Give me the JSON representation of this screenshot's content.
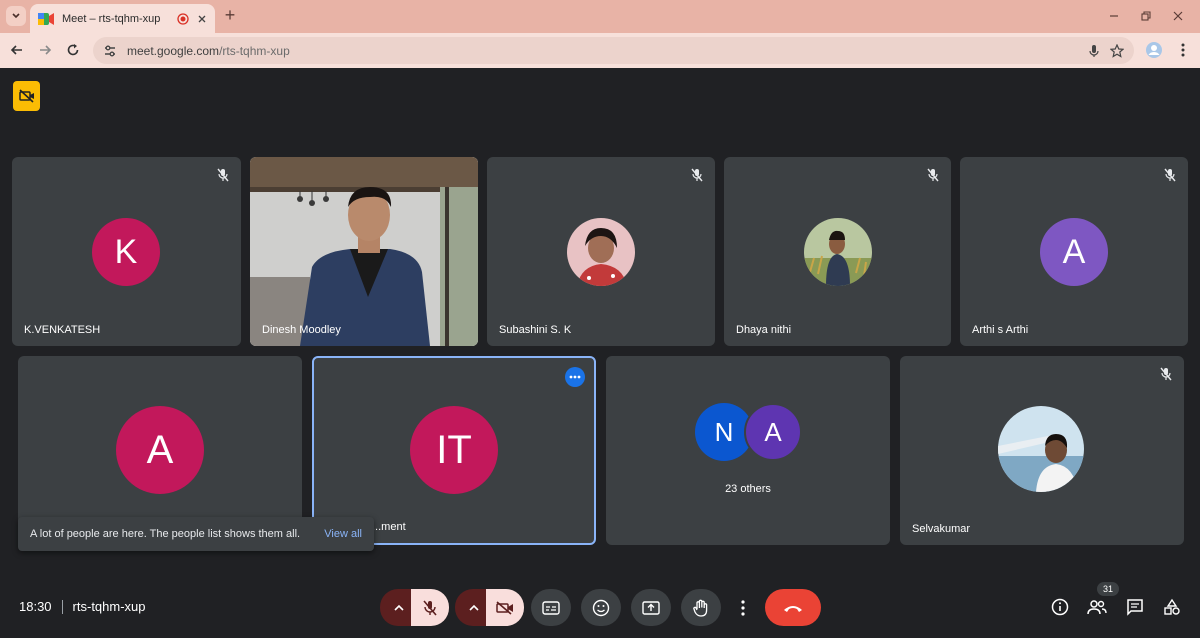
{
  "browser": {
    "tab_title": "Meet – rts-tqhm-xup",
    "url_host": "meet.google.com",
    "url_path": "/rts-tqhm-xup",
    "new_tab_label": "+"
  },
  "tiles_row1": [
    {
      "name": "K.VENKATESH",
      "initial": "K",
      "color": "#c2185b",
      "muted": true
    },
    {
      "name": "Dinesh Moodley",
      "video": true,
      "muted": false
    },
    {
      "name": "Subashini S. K",
      "photo": true,
      "muted": true
    },
    {
      "name": "Dhaya nithi",
      "photo": true,
      "muted": true
    },
    {
      "name": "Arthi s Arthi",
      "initial": "A",
      "color": "#7e57c2",
      "muted": true
    }
  ],
  "tiles_row2": [
    {
      "name": "",
      "initial": "A",
      "color": "#c2185b"
    },
    {
      "name": "...ment",
      "initial": "IT",
      "color": "#c2185b"
    },
    {
      "others_label": "23 others",
      "initials": [
        "N",
        "A"
      ],
      "colors": [
        "#0b57d0",
        "#5e35b1"
      ]
    },
    {
      "name": "Selvakumar",
      "photo": true,
      "muted": true
    }
  ],
  "toast": {
    "text": "A lot of people are here. The people list shows them all.",
    "link": "View all"
  },
  "bottom": {
    "time": "18:30",
    "meeting_code": "rts-tqhm-xup",
    "participant_count": "31"
  },
  "colors": {
    "background": "#202124",
    "tile": "#3c4043",
    "accent": "#8ab4f8",
    "end_call": "#ea4335",
    "warning": "#fbbc04"
  }
}
